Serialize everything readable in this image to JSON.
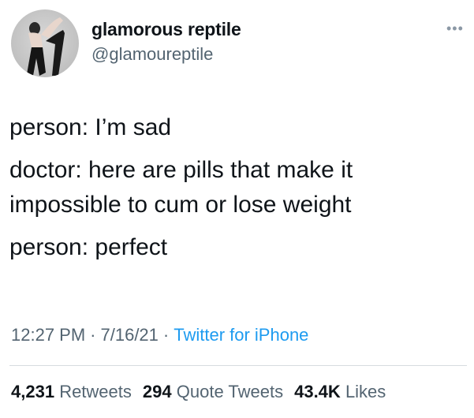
{
  "user": {
    "display_name": "glamorous reptile",
    "handle": "@glamoureptile",
    "avatar_icon": "profile-photo"
  },
  "more_icon": "•••",
  "tweet_text": [
    "person: I’m sad",
    "doctor: here are pills that make it impossible to cum or lose weight",
    "person: perfect"
  ],
  "meta": {
    "time": "12:27 PM",
    "date": "7/16/21",
    "source": "Twitter for iPhone",
    "separator": "·"
  },
  "stats": {
    "retweets_count": "4,231",
    "retweets_label": "Retweets",
    "quotes_count": "294",
    "quotes_label": "Quote Tweets",
    "likes_count": "43.4K",
    "likes_label": "Likes"
  },
  "colors": {
    "text": "#0f1419",
    "secondary": "#536471",
    "link": "#1d9bf0"
  }
}
